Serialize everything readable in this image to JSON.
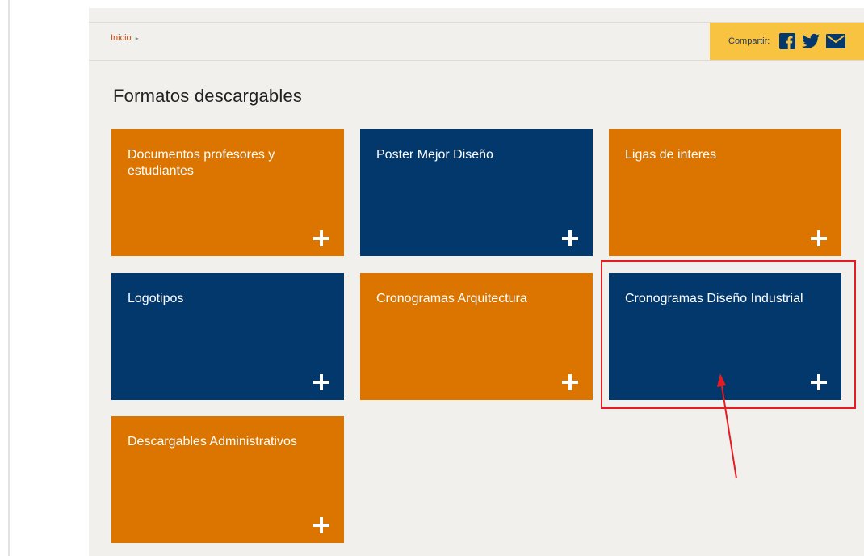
{
  "breadcrumb": {
    "home_label": "Inicio",
    "separator": "▸"
  },
  "share": {
    "label": "Compartir:",
    "icons": [
      "facebook-icon",
      "twitter-icon",
      "mail-icon"
    ],
    "background": "#f8c341",
    "icon_color": "#02386c"
  },
  "page": {
    "title": "Formatos descargables"
  },
  "tiles": [
    {
      "label": "Documentos profesores y estudiantes",
      "color": "orange",
      "icon": "plus-icon"
    },
    {
      "label": "Poster Mejor Diseño",
      "color": "navy",
      "icon": "plus-icon"
    },
    {
      "label": "Ligas de interes",
      "color": "orange",
      "icon": "plus-icon"
    },
    {
      "label": "Logotipos",
      "color": "navy",
      "icon": "plus-icon"
    },
    {
      "label": "Cronogramas Arquitectura",
      "color": "orange",
      "icon": "plus-icon"
    },
    {
      "label": "Cronogramas Diseño Industrial",
      "color": "navy",
      "icon": "plus-icon"
    },
    {
      "label": "Descargables Administrativos",
      "color": "orange",
      "icon": "plus-icon"
    }
  ],
  "colors": {
    "orange": "#db7500",
    "navy": "#02386c",
    "annotation": "#e51c23"
  }
}
